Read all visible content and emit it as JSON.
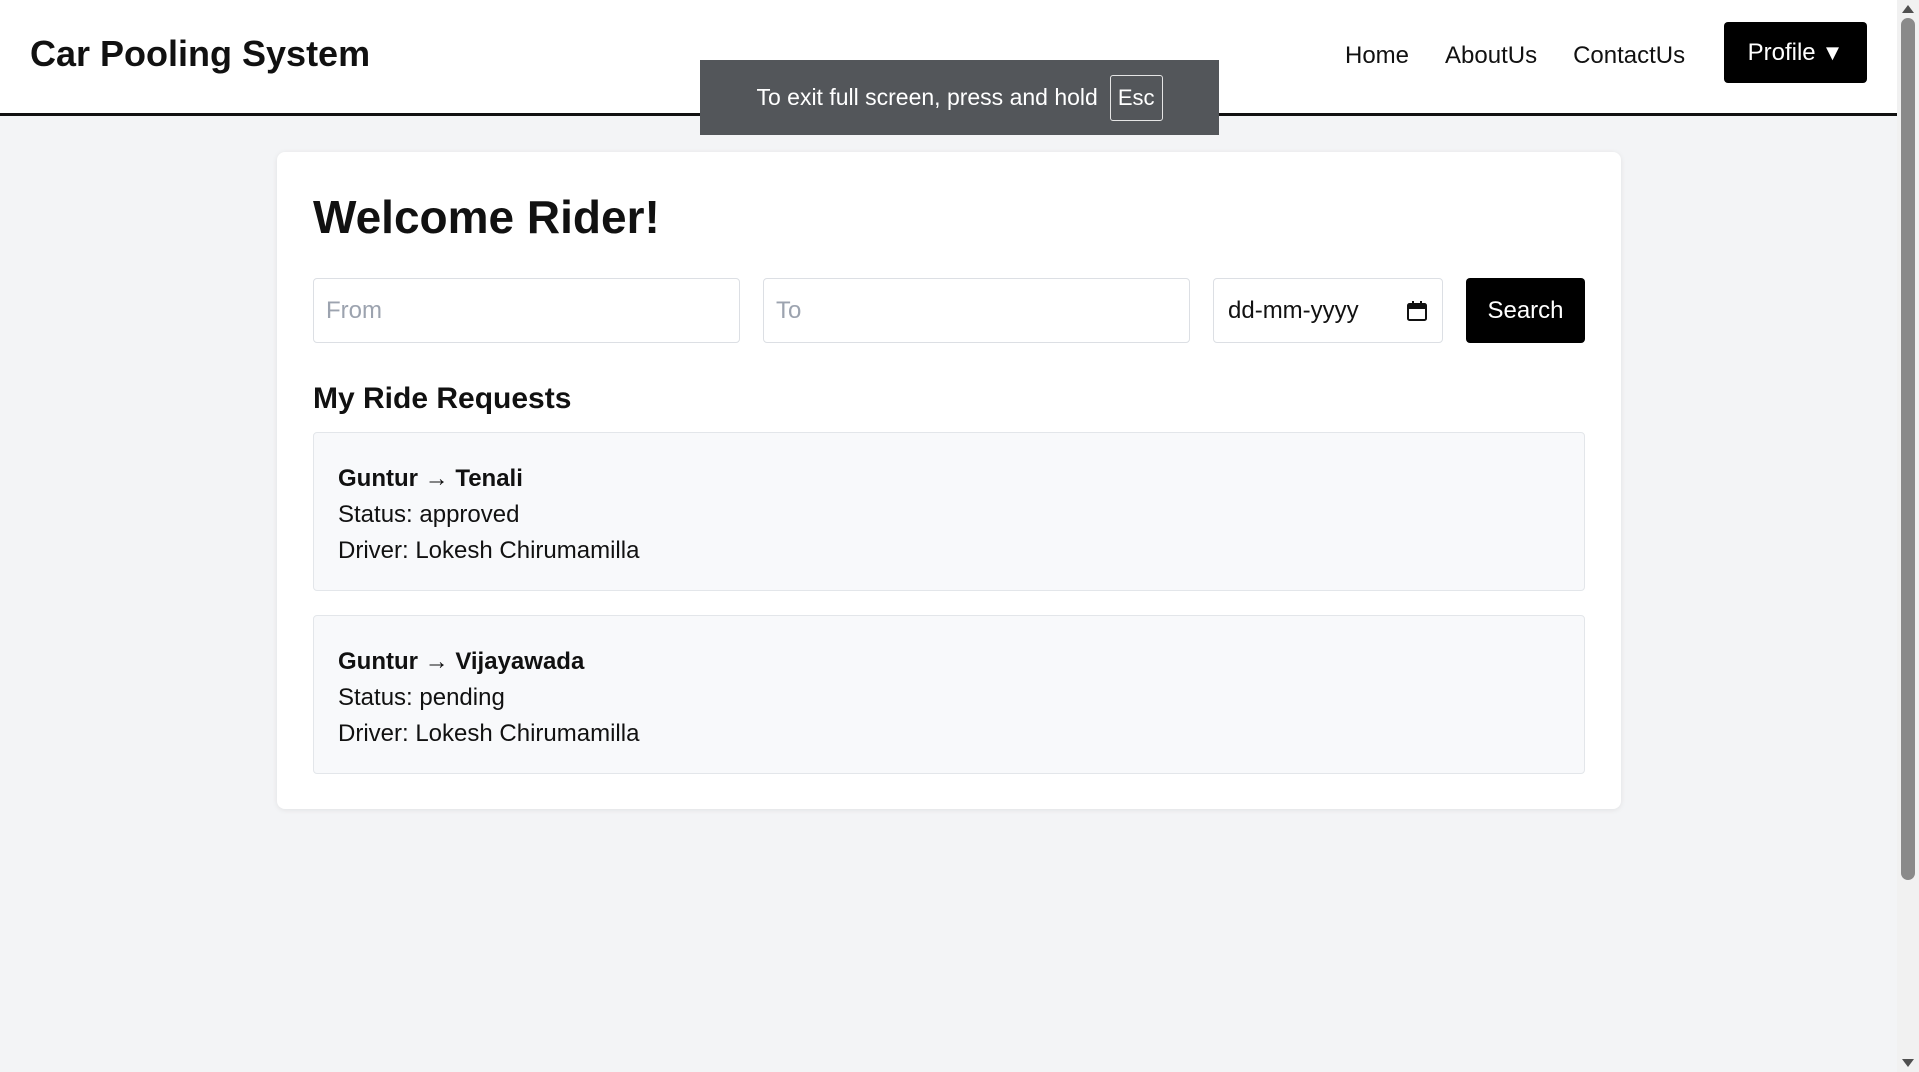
{
  "navbar": {
    "brand": "Car Pooling System",
    "links": [
      "Home",
      "AboutUs",
      "ContactUs"
    ],
    "profile_label": "Profile",
    "profile_caret": "▼"
  },
  "fullscreen_toast": {
    "text": "To exit full screen, press and hold",
    "key": "Esc"
  },
  "main": {
    "welcome": "Welcome Rider!",
    "search": {
      "from_placeholder": "From",
      "to_placeholder": "To",
      "date_placeholder": "dd-mm-yyyy",
      "button_label": "Search"
    },
    "section_title": "My Ride Requests",
    "rides": [
      {
        "route": "Guntur → Tenali",
        "status": "Status: approved",
        "driver": "Driver: Lokesh Chirumamilla"
      },
      {
        "route": "Guntur → Vijayawada",
        "status": "Status: pending",
        "driver": "Driver: Lokesh Chirumamilla"
      }
    ]
  },
  "colors": {
    "background": "#f3f4f6",
    "accent": "#000000",
    "card": "#ffffff",
    "ride_card": "#f8f9fb"
  }
}
